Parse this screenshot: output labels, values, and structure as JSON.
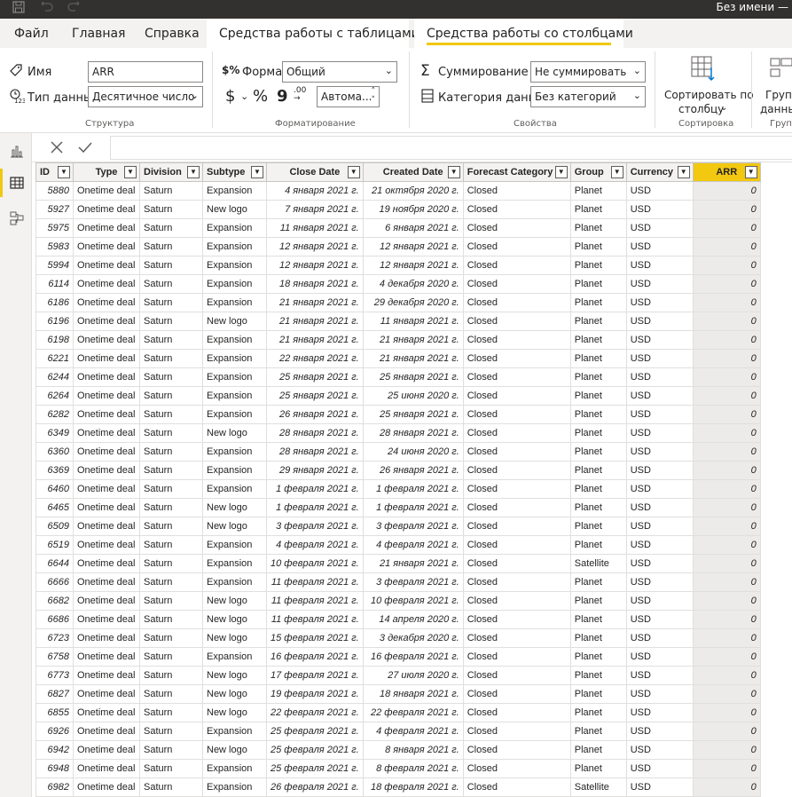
{
  "title_bar": {
    "title": "Без имени —"
  },
  "ribbon_tabs": [
    {
      "label": "Файл"
    },
    {
      "label": "Главная"
    },
    {
      "label": "Справка"
    },
    {
      "label": "Средства работы с таблицами"
    },
    {
      "label": "Средства работы со столбцами"
    }
  ],
  "ribbon": {
    "structure": {
      "name_label": "Имя",
      "name_value": "ARR",
      "datatype_label": "Тип данных",
      "datatype_value": "Десятичное число",
      "group_label": "Структура"
    },
    "formatting": {
      "format_label": "Формат",
      "format_value": "Общий",
      "currency_symbol": "$",
      "percent_symbol": "%",
      "comma_symbol": "9",
      "decimals_icon": ".00",
      "auto_value": "Автома...",
      "group_label": "Форматирование"
    },
    "properties": {
      "summarization_label": "Суммирование",
      "summarization_value": "Не суммировать",
      "category_label": "Категория данных",
      "category_value": "Без категорий",
      "group_label": "Свойства"
    },
    "sort": {
      "button_line1": "Сортировать по",
      "button_line2": "столбцу",
      "group_label": "Сортировка"
    },
    "groups": {
      "button_line1": "Групп",
      "button_line2": "данны",
      "group_label": "Групп"
    }
  },
  "table": {
    "columns": [
      "ID",
      "Type",
      "Division",
      "Subtype",
      "Close Date",
      "Created Date",
      "Forecast Category",
      "Group",
      "Currency",
      "ARR"
    ],
    "rows": [
      [
        "5880",
        "Onetime deal",
        "Saturn",
        "Expansion",
        "4 января 2021 г.",
        "21 октября 2020 г.",
        "Closed",
        "Planet",
        "USD",
        "0"
      ],
      [
        "5927",
        "Onetime deal",
        "Saturn",
        "New logo",
        "7 января 2021 г.",
        "19 ноября 2020 г.",
        "Closed",
        "Planet",
        "USD",
        "0"
      ],
      [
        "5975",
        "Onetime deal",
        "Saturn",
        "Expansion",
        "11 января 2021 г.",
        "6 января 2021 г.",
        "Closed",
        "Planet",
        "USD",
        "0"
      ],
      [
        "5983",
        "Onetime deal",
        "Saturn",
        "Expansion",
        "12 января 2021 г.",
        "12 января 2021 г.",
        "Closed",
        "Planet",
        "USD",
        "0"
      ],
      [
        "5994",
        "Onetime deal",
        "Saturn",
        "Expansion",
        "12 января 2021 г.",
        "12 января 2021 г.",
        "Closed",
        "Planet",
        "USD",
        "0"
      ],
      [
        "6114",
        "Onetime deal",
        "Saturn",
        "Expansion",
        "18 января 2021 г.",
        "4 декабря 2020 г.",
        "Closed",
        "Planet",
        "USD",
        "0"
      ],
      [
        "6186",
        "Onetime deal",
        "Saturn",
        "Expansion",
        "21 января 2021 г.",
        "29 декабря 2020 г.",
        "Closed",
        "Planet",
        "USD",
        "0"
      ],
      [
        "6196",
        "Onetime deal",
        "Saturn",
        "New logo",
        "21 января 2021 г.",
        "11 января 2021 г.",
        "Closed",
        "Planet",
        "USD",
        "0"
      ],
      [
        "6198",
        "Onetime deal",
        "Saturn",
        "Expansion",
        "21 января 2021 г.",
        "21 января 2021 г.",
        "Closed",
        "Planet",
        "USD",
        "0"
      ],
      [
        "6221",
        "Onetime deal",
        "Saturn",
        "Expansion",
        "22 января 2021 г.",
        "21 января 2021 г.",
        "Closed",
        "Planet",
        "USD",
        "0"
      ],
      [
        "6244",
        "Onetime deal",
        "Saturn",
        "Expansion",
        "25 января 2021 г.",
        "25 января 2021 г.",
        "Closed",
        "Planet",
        "USD",
        "0"
      ],
      [
        "6264",
        "Onetime deal",
        "Saturn",
        "Expansion",
        "25 января 2021 г.",
        "25 июня 2020 г.",
        "Closed",
        "Planet",
        "USD",
        "0"
      ],
      [
        "6282",
        "Onetime deal",
        "Saturn",
        "Expansion",
        "26 января 2021 г.",
        "25 января 2021 г.",
        "Closed",
        "Planet",
        "USD",
        "0"
      ],
      [
        "6349",
        "Onetime deal",
        "Saturn",
        "New logo",
        "28 января 2021 г.",
        "28 января 2021 г.",
        "Closed",
        "Planet",
        "USD",
        "0"
      ],
      [
        "6360",
        "Onetime deal",
        "Saturn",
        "Expansion",
        "28 января 2021 г.",
        "24 июня 2020 г.",
        "Closed",
        "Planet",
        "USD",
        "0"
      ],
      [
        "6369",
        "Onetime deal",
        "Saturn",
        "Expansion",
        "29 января 2021 г.",
        "26 января 2021 г.",
        "Closed",
        "Planet",
        "USD",
        "0"
      ],
      [
        "6460",
        "Onetime deal",
        "Saturn",
        "Expansion",
        "1 февраля 2021 г.",
        "1 февраля 2021 г.",
        "Closed",
        "Planet",
        "USD",
        "0"
      ],
      [
        "6465",
        "Onetime deal",
        "Saturn",
        "New logo",
        "1 февраля 2021 г.",
        "1 февраля 2021 г.",
        "Closed",
        "Planet",
        "USD",
        "0"
      ],
      [
        "6509",
        "Onetime deal",
        "Saturn",
        "New logo",
        "3 февраля 2021 г.",
        "3 февраля 2021 г.",
        "Closed",
        "Planet",
        "USD",
        "0"
      ],
      [
        "6519",
        "Onetime deal",
        "Saturn",
        "Expansion",
        "4 февраля 2021 г.",
        "4 февраля 2021 г.",
        "Closed",
        "Planet",
        "USD",
        "0"
      ],
      [
        "6644",
        "Onetime deal",
        "Saturn",
        "Expansion",
        "10 февраля 2021 г.",
        "21 января 2021 г.",
        "Closed",
        "Satellite",
        "USD",
        "0"
      ],
      [
        "6666",
        "Onetime deal",
        "Saturn",
        "Expansion",
        "11 февраля 2021 г.",
        "3 февраля 2021 г.",
        "Closed",
        "Planet",
        "USD",
        "0"
      ],
      [
        "6682",
        "Onetime deal",
        "Saturn",
        "New logo",
        "11 февраля 2021 г.",
        "10 февраля 2021 г.",
        "Closed",
        "Planet",
        "USD",
        "0"
      ],
      [
        "6686",
        "Onetime deal",
        "Saturn",
        "New logo",
        "11 февраля 2021 г.",
        "14 апреля 2020 г.",
        "Closed",
        "Planet",
        "USD",
        "0"
      ],
      [
        "6723",
        "Onetime deal",
        "Saturn",
        "New logo",
        "15 февраля 2021 г.",
        "3 декабря 2020 г.",
        "Closed",
        "Planet",
        "USD",
        "0"
      ],
      [
        "6758",
        "Onetime deal",
        "Saturn",
        "Expansion",
        "16 февраля 2021 г.",
        "16 февраля 2021 г.",
        "Closed",
        "Planet",
        "USD",
        "0"
      ],
      [
        "6773",
        "Onetime deal",
        "Saturn",
        "New logo",
        "17 февраля 2021 г.",
        "27 июля 2020 г.",
        "Closed",
        "Planet",
        "USD",
        "0"
      ],
      [
        "6827",
        "Onetime deal",
        "Saturn",
        "New logo",
        "19 февраля 2021 г.",
        "18 января 2021 г.",
        "Closed",
        "Planet",
        "USD",
        "0"
      ],
      [
        "6855",
        "Onetime deal",
        "Saturn",
        "New logo",
        "22 февраля 2021 г.",
        "22 февраля 2021 г.",
        "Closed",
        "Planet",
        "USD",
        "0"
      ],
      [
        "6926",
        "Onetime deal",
        "Saturn",
        "Expansion",
        "25 февраля 2021 г.",
        "4 февраля 2021 г.",
        "Closed",
        "Planet",
        "USD",
        "0"
      ],
      [
        "6942",
        "Onetime deal",
        "Saturn",
        "New logo",
        "25 февраля 2021 г.",
        "8 января 2021 г.",
        "Closed",
        "Planet",
        "USD",
        "0"
      ],
      [
        "6948",
        "Onetime deal",
        "Saturn",
        "Expansion",
        "25 февраля 2021 г.",
        "8 февраля 2021 г.",
        "Closed",
        "Planet",
        "USD",
        "0"
      ],
      [
        "6982",
        "Onetime deal",
        "Saturn",
        "Expansion",
        "26 февраля 2021 г.",
        "18 февраля 2021 г.",
        "Closed",
        "Satellite",
        "USD",
        "0"
      ]
    ]
  },
  "colors": {
    "accent": "#f2c811",
    "selected_column_bg": "#edebe9"
  }
}
